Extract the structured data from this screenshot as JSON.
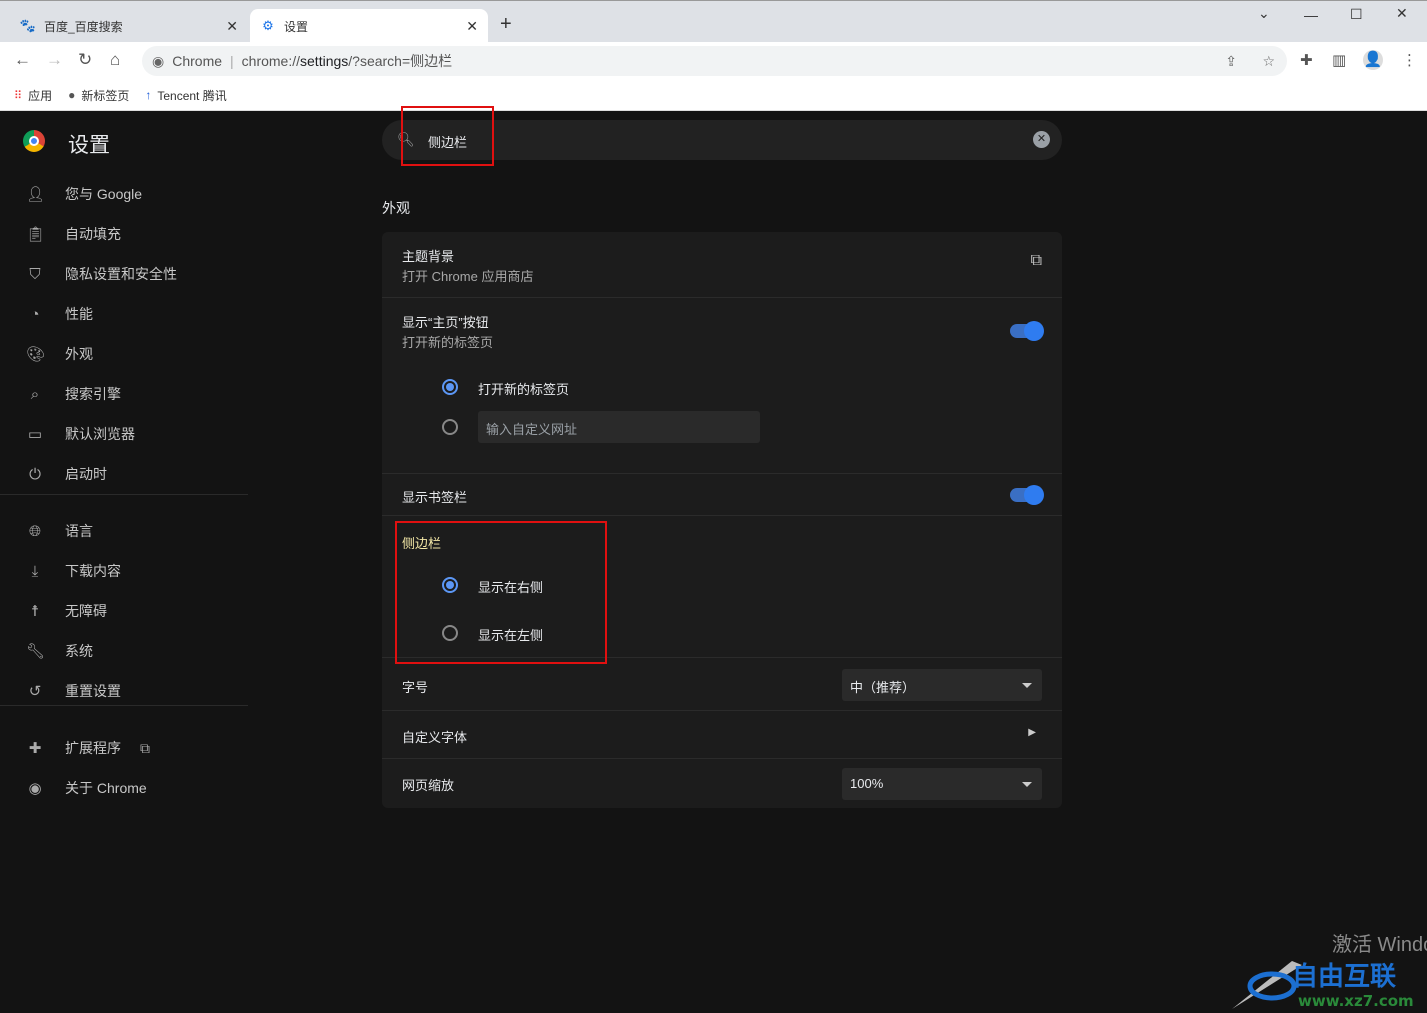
{
  "tabs": [
    {
      "title": "百度_百度搜索",
      "icon": "baidu-paw-icon"
    },
    {
      "title": "设置",
      "icon": "gear-icon",
      "active": true
    }
  ],
  "address": {
    "site_label": "Chrome",
    "url_prefix": "chrome://",
    "url_host": "settings",
    "url_rest": "/?search=侧边栏"
  },
  "bookmarks": [
    {
      "label": "应用",
      "icon": "apps-grid-icon"
    },
    {
      "label": "新标签页",
      "icon": "globe-icon"
    },
    {
      "label": "Tencent 腾讯",
      "icon": "tencent-icon"
    }
  ],
  "settings": {
    "title": "设置",
    "search_value": "侧边栏"
  },
  "sidebar": {
    "items": [
      {
        "label": "您与 Google",
        "icon": "person-icon"
      },
      {
        "label": "自动填充",
        "icon": "clipboard-icon"
      },
      {
        "label": "隐私设置和安全性",
        "icon": "shield-icon"
      },
      {
        "label": "性能",
        "icon": "speedometer-icon"
      },
      {
        "label": "外观",
        "icon": "palette-icon"
      },
      {
        "label": "搜索引擎",
        "icon": "search-icon"
      },
      {
        "label": "默认浏览器",
        "icon": "browser-icon"
      },
      {
        "label": "启动时",
        "icon": "power-icon"
      },
      {
        "label": "语言",
        "icon": "globe-icon"
      },
      {
        "label": "下载内容",
        "icon": "download-icon"
      },
      {
        "label": "无障碍",
        "icon": "accessibility-icon"
      },
      {
        "label": "系统",
        "icon": "wrench-icon"
      },
      {
        "label": "重置设置",
        "icon": "history-icon"
      },
      {
        "label": "扩展程序",
        "icon": "puzzle-icon"
      },
      {
        "label": "关于 Chrome",
        "icon": "chrome-icon"
      }
    ]
  },
  "appearance": {
    "section": "外观",
    "theme": {
      "title": "主题背景",
      "subtitle": "打开 Chrome 应用商店"
    },
    "home": {
      "title": "显示“主页”按钮",
      "subtitle": "打开新的标签页",
      "enabled": true,
      "opt_newtab": "打开新的标签页",
      "opt_custom_placeholder": "输入自定义网址"
    },
    "bookmarks_bar": {
      "title": "显示书签栏",
      "enabled": true
    },
    "side_panel": {
      "title": "侧边栏",
      "opt_right": "显示在右侧",
      "opt_left": "显示在左侧",
      "selected": "right"
    },
    "font_size": {
      "title": "字号",
      "value": "中（推荐）"
    },
    "custom_fonts": {
      "title": "自定义字体"
    },
    "zoom": {
      "title": "网页缩放",
      "value": "100%"
    }
  },
  "colors": {
    "accent": "#5c97f5",
    "highlight": "#e01010"
  },
  "watermark": {
    "activation": "激活 Windows",
    "logo_text": "自由互联 www.xz7.com"
  }
}
